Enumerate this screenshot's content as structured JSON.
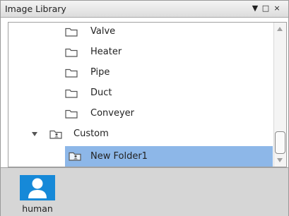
{
  "panel": {
    "title": "Image Library",
    "buttons": {
      "dropdown": "▼",
      "restore": "□",
      "close": "×"
    }
  },
  "tree": {
    "items": [
      {
        "label": "Valve",
        "icon": "folder-icon"
      },
      {
        "label": "Heater",
        "icon": "folder-icon"
      },
      {
        "label": "Pipe",
        "icon": "folder-icon"
      },
      {
        "label": "Duct",
        "icon": "folder-icon"
      },
      {
        "label": "Conveyer",
        "icon": "folder-icon"
      },
      {
        "label": "Custom",
        "icon": "folder-user-icon",
        "expanded": true
      },
      {
        "label": "New Folder1",
        "icon": "folder-user-icon",
        "selected": true
      }
    ]
  },
  "gallery": {
    "items": [
      {
        "label": "human",
        "icon": "person-icon"
      }
    ]
  },
  "colors": {
    "selection": "#8db7e8",
    "tile": "#1689d8",
    "gallery_bg": "#d6d6d6"
  }
}
